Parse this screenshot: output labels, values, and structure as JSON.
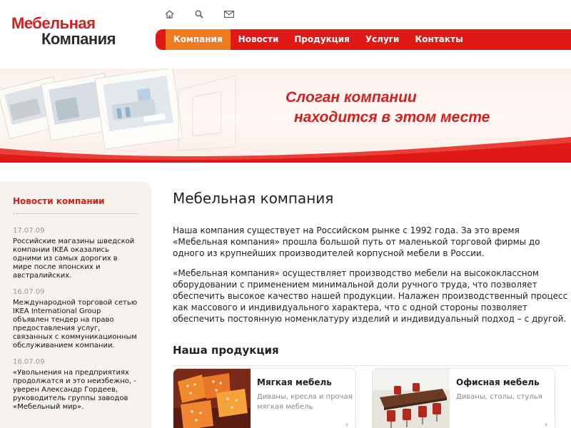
{
  "logo": {
    "line1": "Мебельная",
    "line2": "Компания"
  },
  "top_icons": [
    "home-icon",
    "search-icon",
    "mail-icon"
  ],
  "nav": {
    "items": [
      {
        "label": "Компания",
        "active": true
      },
      {
        "label": "Новости",
        "active": false
      },
      {
        "label": "Продукция",
        "active": false
      },
      {
        "label": "Услуги",
        "active": false
      },
      {
        "label": "Контакты",
        "active": false
      }
    ]
  },
  "banner": {
    "slogan_line1": "Слоган компании",
    "slogan_line2": "находится в этом месте"
  },
  "sidebar": {
    "title": "Новости компании",
    "news": [
      {
        "date": "17.07.09",
        "text": "Российские магазины шведской компании IKEA оказались одними из самых дорогих в мире после японских и австралийских."
      },
      {
        "date": "16.07.09",
        "text": "Международной торговой сетью IKEA International Group объявлен тендер на право предоставления услуг, связанных с коммуникационным обслуживанием компании."
      },
      {
        "date": "16.07.09",
        "text": "«Увольнения на предприятиях продолжатся и это неизбежно, - уверен Александр Гордеев, руководитель группы заводов «Мебельный мир»."
      }
    ]
  },
  "main": {
    "title": "Мебельная компания",
    "paragraphs": [
      "Наша компания существует на Российском рынке с 1992 года. За это время «Мебельная компания» прошла большой путь от маленькой торговой фирмы до одного из крупнейших производителей корпусной мебели в России.",
      "«Мебельная компания» осуществляет производство мебели на высококлассном оборудовании с применением минимальной доли ручного труда, что позволяет обеспечить высокое качество нашей продукции. Налажен производственный процесс как массового и индивидуального характера, что с одной стороны позволяет обеспечить постоянную номенклатуру изделий и индивидуальный подход – с другой."
    ],
    "products_title": "Наша продукция",
    "products": [
      {
        "title": "Мягкая мебель",
        "desc": "Диваны, кресла и прочая мягкая мебель",
        "arrow": "›"
      },
      {
        "title": "Офисная мебель",
        "desc": "Диваны, столы, стулья",
        "arrow": "›"
      }
    ]
  },
  "colors": {
    "accent": "#e01818",
    "active_tab": "#f07a1e",
    "sidebar_bg": "#f6f3ee"
  }
}
